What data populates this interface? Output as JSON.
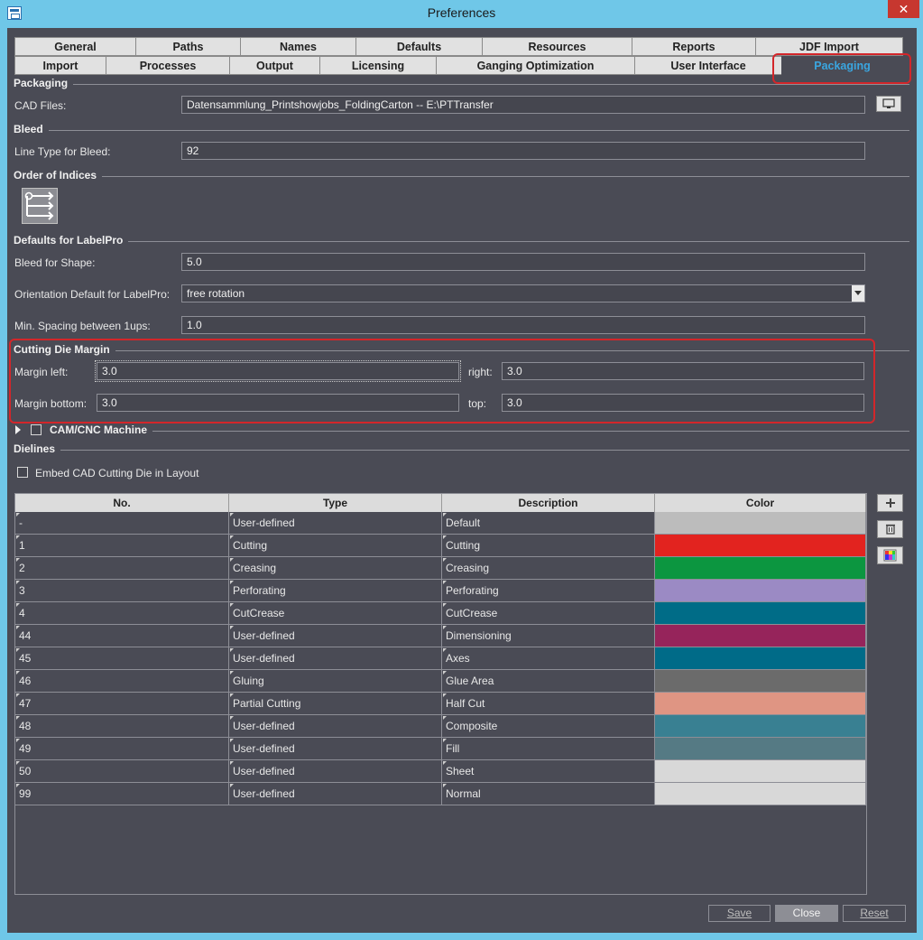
{
  "window": {
    "title": "Preferences",
    "close_glyph": "✕"
  },
  "tabs": {
    "row1": [
      "General",
      "Paths",
      "Names",
      "Defaults",
      "Resources",
      "Reports",
      "JDF Import"
    ],
    "row2": [
      "Import",
      "Processes",
      "Output",
      "Licensing",
      "Ganging Optimization",
      "User Interface",
      "Packaging"
    ],
    "active": "Packaging"
  },
  "packaging": {
    "section": "Packaging",
    "cad_files_label": "CAD Files:",
    "cad_files_value": "Datensammlung_Printshowjobs_FoldingCarton -- E:\\PTTransfer",
    "browse_icon": "monitor-icon"
  },
  "bleed": {
    "section": "Bleed",
    "line_type_label": "Line Type for Bleed:",
    "line_type_value": "92"
  },
  "order": {
    "section": "Order of Indices",
    "icon": "order-list-icon"
  },
  "labelpro": {
    "section": "Defaults for LabelPro",
    "bleed_shape_label": "Bleed for Shape:",
    "bleed_shape_value": "5.0",
    "orientation_label": "Orientation Default for LabelPro:",
    "orientation_value": "free rotation",
    "spacing_label": "Min. Spacing between 1ups:",
    "spacing_value": "1.0"
  },
  "cutting_die": {
    "section": "Cutting Die Margin",
    "left_label": "Margin left:",
    "left_value": "3.0",
    "right_label": "right:",
    "right_value": "3.0",
    "bottom_label": "Margin bottom:",
    "bottom_value": "3.0",
    "top_label": "top:",
    "top_value": "3.0"
  },
  "cam": {
    "label": "CAM/CNC Machine"
  },
  "dielines": {
    "section": "Dielines",
    "embed_label": "Embed CAD Cutting Die in Layout",
    "columns": [
      "No.",
      "Type",
      "Description",
      "Color"
    ],
    "rows": [
      {
        "no": "-",
        "type": "User-defined",
        "desc": "Default",
        "color": "#bcbcbc"
      },
      {
        "no": "1",
        "type": "Cutting",
        "desc": "Cutting",
        "color": "#e2231f"
      },
      {
        "no": "2",
        "type": "Creasing",
        "desc": "Creasing",
        "color": "#0c9640"
      },
      {
        "no": "3",
        "type": "Perforating",
        "desc": "Perforating",
        "color": "#9b8ac4"
      },
      {
        "no": "4",
        "type": "CutCrease",
        "desc": "CutCrease",
        "color": "#006c87"
      },
      {
        "no": "44",
        "type": "User-defined",
        "desc": "Dimensioning",
        "color": "#96245b"
      },
      {
        "no": "45",
        "type": "User-defined",
        "desc": "Axes",
        "color": "#006b88"
      },
      {
        "no": "46",
        "type": "Gluing",
        "desc": "Glue Area",
        "color": "#6b6b6b"
      },
      {
        "no": "47",
        "type": "Partial Cutting",
        "desc": "Half Cut",
        "color": "#df9583"
      },
      {
        "no": "48",
        "type": "User-defined",
        "desc": "Composite",
        "color": "#398092"
      },
      {
        "no": "49",
        "type": "User-defined",
        "desc": "Fill",
        "color": "#557a84"
      },
      {
        "no": "50",
        "type": "User-defined",
        "desc": "Sheet",
        "color": "#d8d8d8"
      },
      {
        "no": "99",
        "type": "User-defined",
        "desc": "Normal",
        "color": "#d8d8d8"
      }
    ],
    "add_icon": "plus-icon",
    "delete_icon": "trash-icon",
    "color_icon": "color-palette-icon"
  },
  "buttons": {
    "save": "Save",
    "close": "Close",
    "reset": "Reset"
  },
  "colors": {
    "background": "#4a4b55",
    "titlebar": "#6fc7e8",
    "active_tab": "#3aa6e0",
    "highlight": "#d3262a"
  }
}
